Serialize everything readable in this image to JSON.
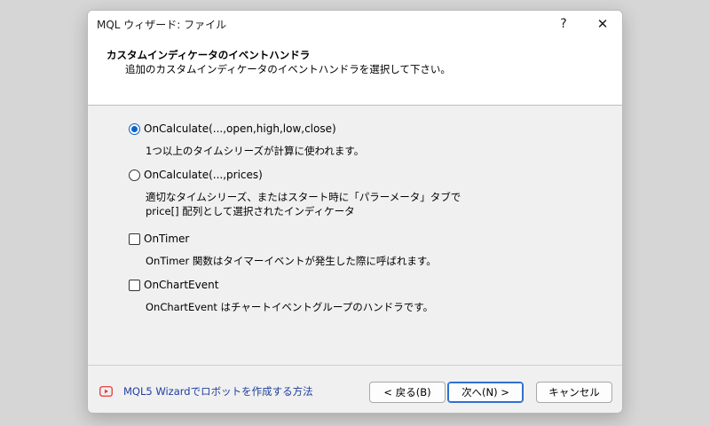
{
  "window": {
    "title": "MQL ウィザード: ファイル",
    "help_symbol": "?",
    "close_symbol": "✕"
  },
  "header": {
    "title": "カスタムインディケータのイベントハンドラ",
    "subtitle": "追加のカスタムインディケータのイベントハンドラを選択して下さい。"
  },
  "options": [
    {
      "label": "OnCalculate(...,open,high,low,close)",
      "control": "radio",
      "checked": true,
      "description": [
        "1つ以上のタイムシリーズが計算に使われます。"
      ]
    },
    {
      "label": "OnCalculate(...,prices)",
      "control": "radio",
      "checked": false,
      "description": [
        "適切なタイムシリーズ、またはスタート時に「パラーメータ」タブで",
        "price[] 配列として選択されたインディケータ"
      ]
    },
    {
      "label": "OnTimer",
      "control": "checkbox",
      "checked": false,
      "description": [
        "OnTimer 関数はタイマーイベントが発生した際に呼ばれます。"
      ]
    },
    {
      "label": "OnChartEvent",
      "control": "checkbox",
      "checked": false,
      "description": [
        "OnChartEvent はチャートイベントグループのハンドラです。"
      ]
    }
  ],
  "footer": {
    "help_link": "MQL5 Wizardでロボットを作成する方法",
    "help_icon": "youtube-icon",
    "buttons": {
      "back": "< 戻る(B)",
      "next": "次へ(N) >",
      "cancel": "キャンセル"
    }
  },
  "colors": {
    "accent": "#0a64c8",
    "link": "#1f3f9e",
    "youtube": "#e53935"
  }
}
